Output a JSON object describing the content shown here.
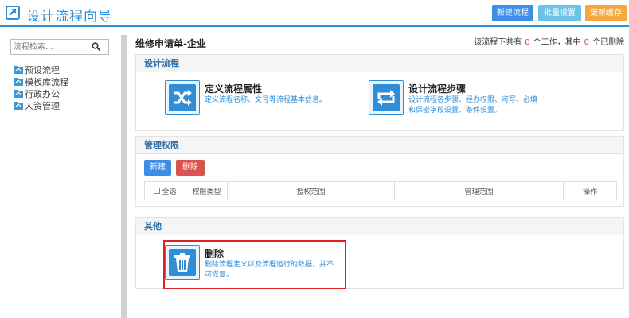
{
  "header": {
    "title": "设计流程向导",
    "buttons": {
      "new_flow": "新建流程",
      "batch_settings": "批量设置",
      "update_cache": "更新缓存"
    }
  },
  "sidebar": {
    "search_placeholder": "流程检索...",
    "tree": [
      {
        "label": "预设流程"
      },
      {
        "label": "模板库流程"
      },
      {
        "label": "行政办公"
      },
      {
        "label": "人资管理"
      }
    ]
  },
  "main": {
    "form_title": "维修申请单-企业",
    "flow_info": {
      "prefix": "该流程下共有",
      "work_count": "0",
      "middle": "个工作，其中",
      "deleted_count": "0",
      "suffix": "个已删除"
    },
    "design_panel": {
      "title": "设计流程",
      "define": {
        "title": "定义流程属性",
        "desc": "定义流程名称、文号等流程基本信息。"
      },
      "steps": {
        "title": "设计流程步骤",
        "desc_line1": "设计流程各步骤、经办权限、可写、必填",
        "desc_line2": "和保密字段设置、条件设置。"
      }
    },
    "perm_panel": {
      "title": "管理权限",
      "add_label": "新建",
      "delete_label": "删除",
      "columns": [
        "全选",
        "权限类型",
        "授权范围",
        "管理范围",
        "操作"
      ]
    },
    "other_panel": {
      "title": "其他",
      "delete": {
        "title": "删除",
        "desc_line1": "删除流程定义以及流程运行的数据，并不",
        "desc_line2": "可恢复。"
      }
    }
  },
  "colors": {
    "primary": "#2f8ed6",
    "danger": "#d9534f",
    "warning": "#f5a742",
    "highlight": "#e02020"
  }
}
